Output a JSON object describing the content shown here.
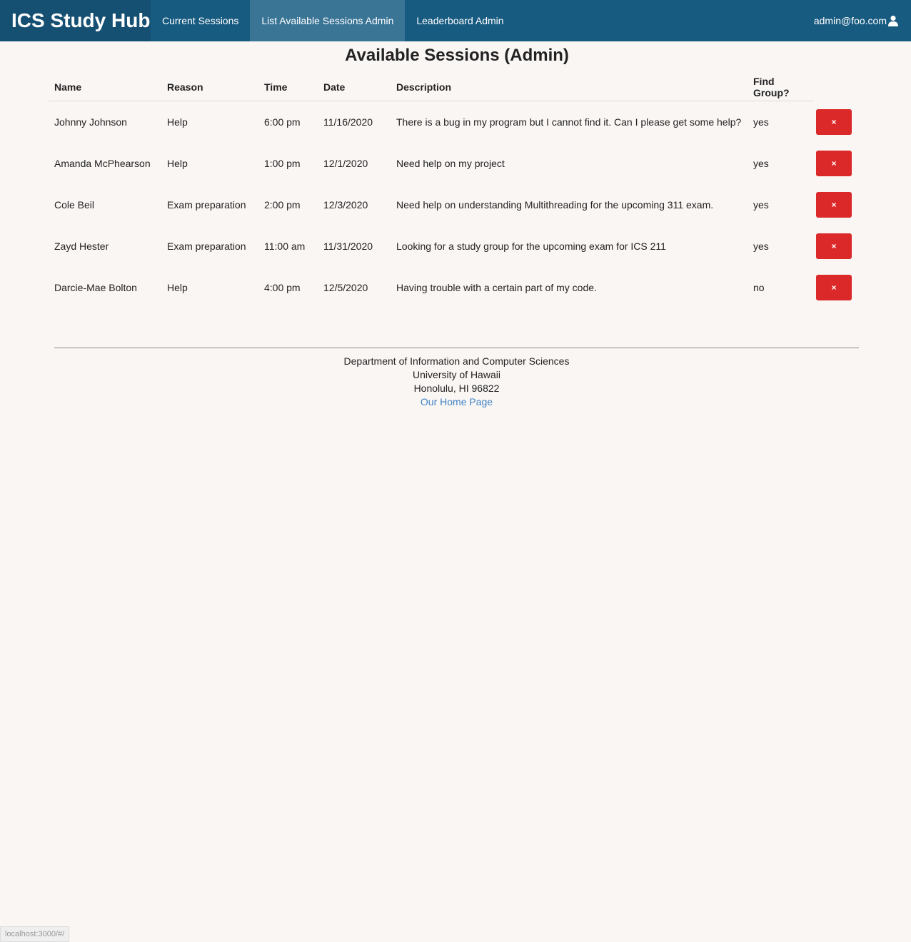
{
  "navbar": {
    "brand": "ICS Study Hub",
    "items": [
      {
        "label": "Current Sessions",
        "active": false
      },
      {
        "label": "List Available Sessions Admin",
        "active": true
      },
      {
        "label": "Leaderboard Admin",
        "active": false
      }
    ],
    "user": "admin@foo.com",
    "user_icon": "user-icon"
  },
  "page": {
    "title": "Available Sessions (Admin)"
  },
  "table": {
    "headers": [
      "Name",
      "Reason",
      "Time",
      "Date",
      "Description",
      "Find Group?"
    ],
    "delete_label": "×",
    "rows": [
      {
        "name": "Johnny Johnson",
        "reason": "Help",
        "time": "6:00 pm",
        "date": "11/16/2020",
        "description": "There is a bug in my program but I cannot find it. Can I please get some help?",
        "find_group": "yes"
      },
      {
        "name": "Amanda McPhearson",
        "reason": "Help",
        "time": "1:00 pm",
        "date": "12/1/2020",
        "description": "Need help on my project",
        "find_group": "yes"
      },
      {
        "name": "Cole Beil",
        "reason": "Exam preparation",
        "time": "2:00 pm",
        "date": "12/3/2020",
        "description": "Need help on understanding Multithreading for the upcoming 311 exam.",
        "find_group": "yes"
      },
      {
        "name": "Zayd Hester",
        "reason": "Exam preparation",
        "time": "11:00 am",
        "date": "11/31/2020",
        "description": "Looking for a study group for the upcoming exam for ICS 211",
        "find_group": "yes"
      },
      {
        "name": "Darcie-Mae Bolton",
        "reason": "Help",
        "time": "4:00 pm",
        "date": "12/5/2020",
        "description": "Having trouble with a certain part of my code.",
        "find_group": "no"
      }
    ]
  },
  "footer": {
    "line1": "Department of Information and Computer Sciences",
    "line2": "University of Hawaii",
    "line3": "Honolulu, HI 96822",
    "link": "Our Home Page"
  },
  "status_bar": {
    "url": "localhost:3000/#/"
  },
  "colors": {
    "navbar": "#185b80",
    "brand_bg": "#155073",
    "active_tab": "#3a7596",
    "delete_button": "#db2828",
    "link": "#4183c4"
  }
}
